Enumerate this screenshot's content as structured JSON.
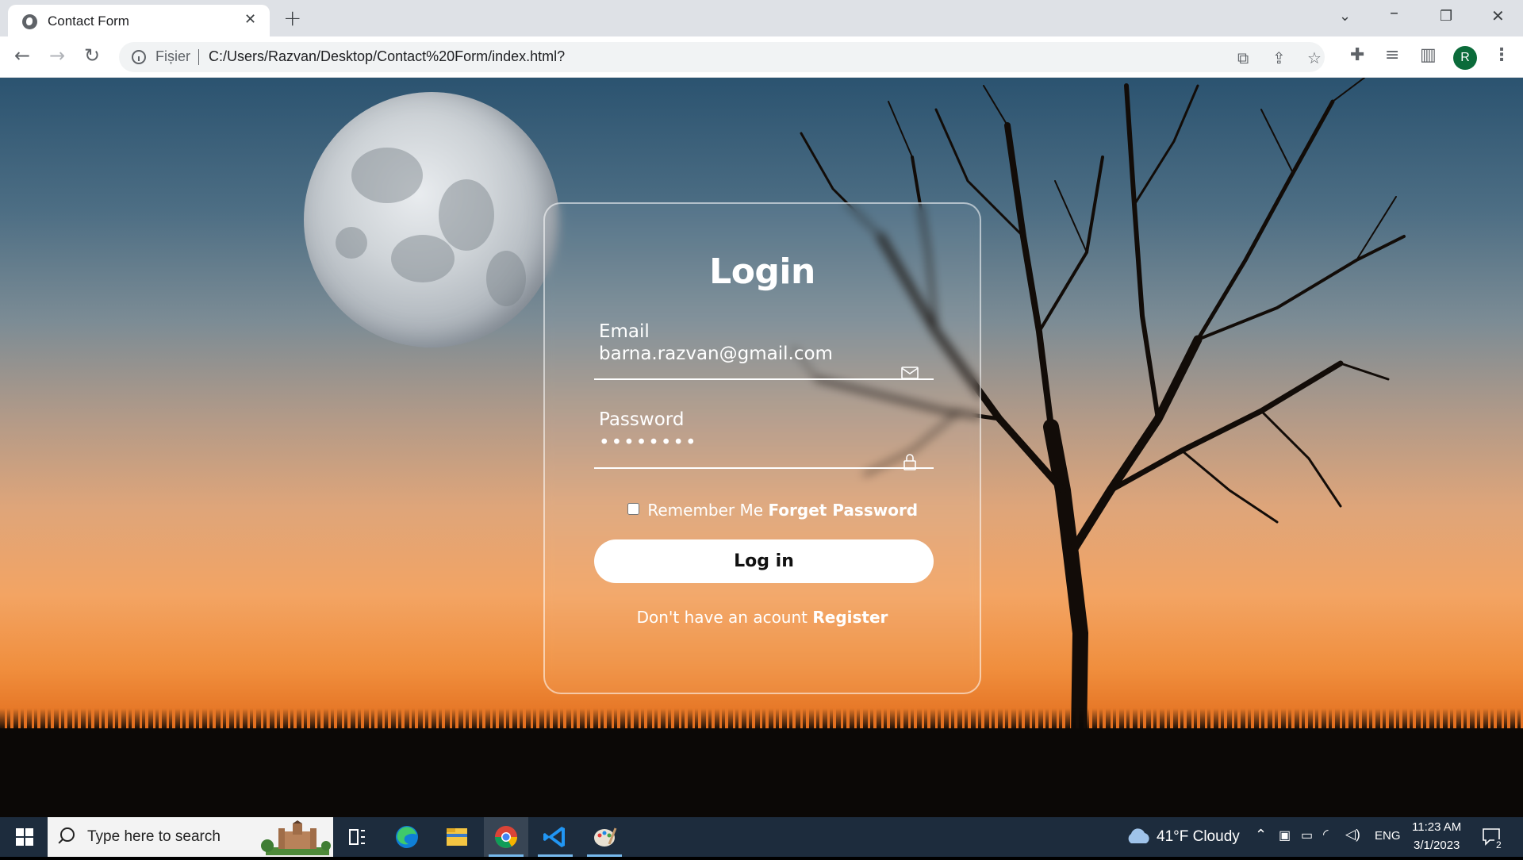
{
  "browser": {
    "tab_title": "Contact Form",
    "tab_close": "✕",
    "new_tab": "+",
    "site_label": "Fișier",
    "url": "C:/Users/Razvan/Desktop/Contact%20Form/index.html?",
    "profile_initial": "R",
    "icons": [
      "back-icon",
      "forward-icon",
      "reload-icon",
      "info-icon",
      "translate-icon",
      "share-icon",
      "bookmark-star-icon",
      "extensions-icon",
      "media-icon",
      "side-panel-icon",
      "profile-avatar",
      "menu-icon"
    ]
  },
  "login": {
    "title": "Login",
    "email_label": "Email",
    "email_value": "barna.razvan@gmail.com",
    "password_label": "Password",
    "password_value": "pass1234",
    "remember_label": "Remember Me",
    "forget_label": "Forget Password",
    "button_label": "Log in",
    "register_prompt": "Don't have an acount",
    "register_link": "Register"
  },
  "taskbar": {
    "search_placeholder": "Type here to search",
    "weather": "41°F  Cloudy",
    "language": "ENG",
    "time": "11:23 AM",
    "date": "3/1/2023",
    "notification_count": "2"
  },
  "colors": {
    "sky_top": "#2b5370",
    "sky_bottom": "#f08e3d",
    "taskbar": "#1d2c3d",
    "profile": "#0b6b3a"
  }
}
